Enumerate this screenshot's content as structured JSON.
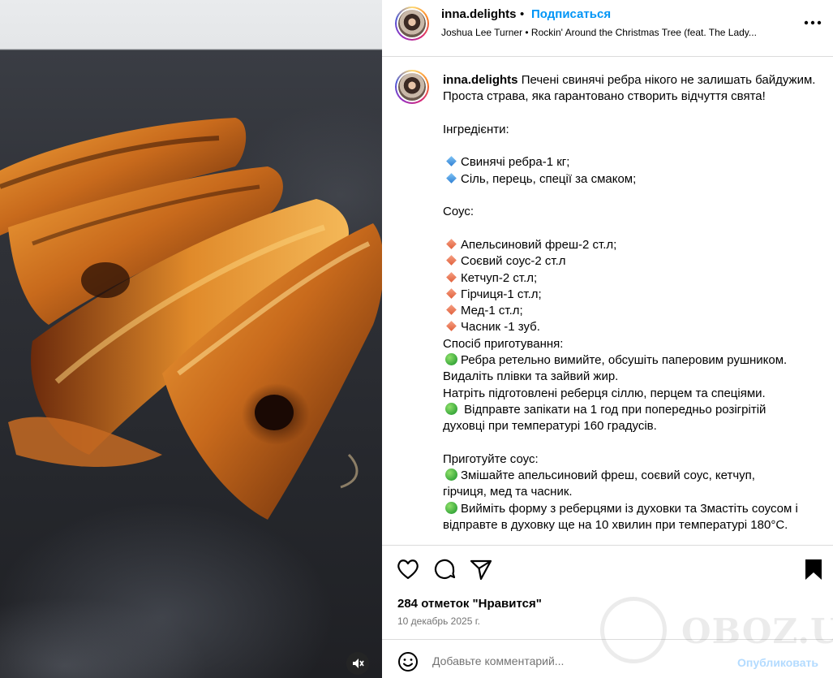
{
  "header": {
    "username": "inna.delights",
    "dot": "•",
    "follow_label": "Подписаться",
    "music": "Joshua Lee Turner • Rockin' Around the Christmas Tree (feat. The Lady..."
  },
  "caption": {
    "username": "inna.delights",
    "intro": "Печені свинячі ребра нікого не залишать байдужим. Проста страва, яка гарантовано створить відчуття свята!",
    "ingredients_title": "Інгредієнти:",
    "ingredients": [
      "Свинячі ребра-1 кг;",
      "Сіль, перець, спеції за смаком;"
    ],
    "sauce_title": "Соус:",
    "sauce": [
      "Апельсиновий фреш-2 ст.л;",
      "Соєвий соус-2 ст.л",
      "Кетчуп-2 ст.л;",
      "Гірчиця-1 ст.л;",
      "Мед-1 ст.л;",
      "Часник -1 зуб."
    ],
    "method_title": "Спосіб приготування:",
    "step1": "Ребра ретельно вимийте, обсушіть паперовим рушником.",
    "step1b": "Видаліть плівки та зайвий жир.",
    "step1c": "Натріть підготовлені реберця сіллю, перцем та спеціями.",
    "step2": " Відправте запікати на 1 год при попередньо розігрітій",
    "step2b": "духовці при температурі 160 градусів.",
    "sauce_prep_title": "Приготуйте соус:",
    "step3": "Змішайте апельсиновий фреш, соєвий соус, кетчуп,",
    "step3b": "гірчиця, мед та часник.",
    "step4": "Вийміть форму з реберцями із духовки та 3мастіть соусом і",
    "step4b": "відправте в духовку ще на 10 хвилин при температурі 180°С."
  },
  "actions": {
    "icons": [
      "heart-icon",
      "comment-icon",
      "share-icon",
      "bookmark-icon"
    ],
    "likes": "284 отметок \"Нравится\"",
    "date": "10 декабрь 2025 г."
  },
  "comment": {
    "placeholder": "Добавьте комментарий...",
    "post_label": "Опубликовать"
  },
  "watermark": "OBOZ.UA",
  "colors": {
    "link_blue": "#0095f6",
    "post_disabled": "#b3dbff",
    "divider": "#dbdbdb",
    "secondary_text": "#737373"
  }
}
